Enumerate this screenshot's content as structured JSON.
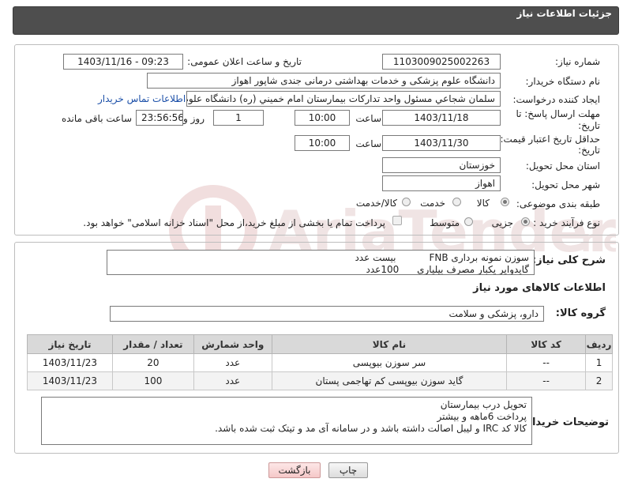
{
  "header": {
    "title": "جزئیات اطلاعات نیاز"
  },
  "fields": {
    "need_number_label": "شماره نیاز:",
    "need_number": "1103009025002263",
    "announce_label": "تاریخ و ساعت اعلان عمومی:",
    "announce_value": "1403/11/16 - 09:23",
    "buyer_org_label": "نام دستگاه خریدار:",
    "buyer_org": "دانشگاه علوم پزشکی و خدمات بهداشتی درمانی جندی شاپور اهواز",
    "requester_label": "ایجاد کننده درخواست:",
    "requester": "سلمان شجاعي مسئول واحد تداركات بيمارستان امام خميني (ره) دانشگاه علوم پزشكي",
    "contact_link": "اطلاعات تماس خریدار",
    "deadline_label_1": "مهلت ارسال پاسخ: تا",
    "deadline_label_2": "تاریخ:",
    "deadline_date": "1403/11/18",
    "hour_label": "ساعت",
    "deadline_time": "10:00",
    "days_value": "1",
    "days_label": "روز و",
    "remaining_time": "23:56:56",
    "remaining_label": "ساعت باقی مانده",
    "validity_label_1": "حداقل تاریخ اعتبار قیمت: تا",
    "validity_label_2": "تاریخ:",
    "validity_date": "1403/11/30",
    "validity_time": "10:00",
    "province_label": "استان محل تحویل:",
    "province": "خوزستان",
    "city_label": "شهر محل تحویل:",
    "city": "اهواز",
    "category_label": "طبقه بندی موضوعی:",
    "category_options": [
      "کالا",
      "خدمت",
      "کالا/خدمت"
    ],
    "category_selected": "کالا",
    "process_label": "نوع فرآیند خرید :",
    "process_options": [
      "جزیی",
      "متوسط"
    ],
    "process_selected": "جزیی",
    "payment_note": "پرداخت تمام یا بخشی از مبلغ خرید،از محل \"اسناد خزانه اسلامی\" خواهد بود."
  },
  "summary": {
    "label": "شرح کلی نیاز:",
    "text": "سوزن نمونه برداری FNB           بیست عدد\nگایدوایر یکبار مصرف بیلیاری      100عدد"
  },
  "goods": {
    "section_title": "اطلاعات کالاهای مورد نیاز",
    "group_label": "گروه کالا:",
    "group_value": "دارو، پزشکی و سلامت"
  },
  "table": {
    "headers": [
      "ردیف",
      "کد کالا",
      "نام کالا",
      "واحد شمارش",
      "تعداد / مقدار",
      "تاریخ نیاز"
    ],
    "rows": [
      [
        "1",
        "--",
        "سر سوزن بیوپسی",
        "عدد",
        "20",
        "1403/11/23"
      ],
      [
        "2",
        "--",
        "گاید سوزن بیوپسی کم تهاجمی پستان",
        "عدد",
        "100",
        "1403/11/23"
      ]
    ]
  },
  "notes": {
    "label": "توضیحات خریدار:",
    "text": "تحویل درب بیمارستان\nپرداخت 6ماهه و بیشتر\nکالا کد IRC و لیبل اصالت داشته باشد و در سامانه آی مد و تیتک ثبت شده باشد."
  },
  "buttons": {
    "print": "چاپ",
    "back": "بازگشت"
  },
  "colors": {
    "header_bg": "#4e4e4e",
    "link": "#1b4fa8",
    "back_button": "#f5c8c8"
  }
}
